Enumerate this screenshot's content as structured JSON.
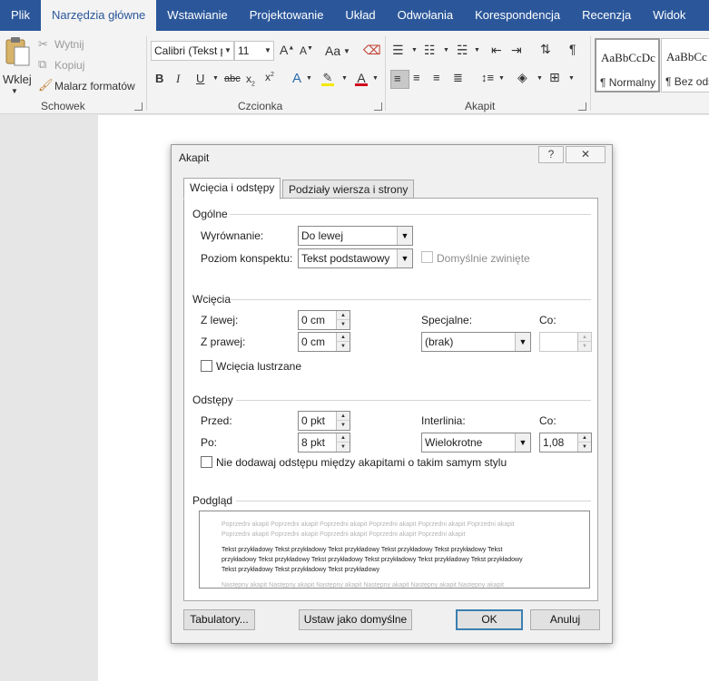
{
  "ribbon": {
    "tabs": [
      "Plik",
      "Narzędzia główne",
      "Wstawianie",
      "Projektowanie",
      "Układ",
      "Odwołania",
      "Korespondencja",
      "Recenzja",
      "Widok"
    ],
    "active_tab": "Narzędzia główne",
    "clipboard": {
      "paste": "Wklej",
      "cut": "Wytnij",
      "copy": "Kopiuj",
      "format_painter": "Malarz formatów",
      "group_label": "Schowek"
    },
    "font": {
      "font_name": "Calibri (Tekst p",
      "font_size": "11",
      "change_case": "Aa",
      "group_label": "Czcionka"
    },
    "paragraph": {
      "group_label": "Akapit",
      "pilcrow": "¶"
    },
    "styles": [
      {
        "sample": "AaBbCcDc",
        "name": "¶ Normalny"
      },
      {
        "sample": "AaBbCc",
        "name": "¶ Bez ods"
      }
    ]
  },
  "dialog": {
    "title": "Akapit",
    "help": "?",
    "close": "✕",
    "tabs": [
      "Wcięcia i odstępy",
      "Podziały wiersza i strony"
    ],
    "general": {
      "section": "Ogólne",
      "alignment_label": "Wyrównanie:",
      "alignment_value": "Do lewej",
      "outline_label": "Poziom konspektu:",
      "outline_value": "Tekst podstawowy",
      "collapsed_label": "Domyślnie zwinięte"
    },
    "indent": {
      "section": "Wcięcia",
      "left_label": "Z lewej:",
      "left_value": "0 cm",
      "right_label": "Z prawej:",
      "right_value": "0 cm",
      "special_label": "Specjalne:",
      "special_value": "(brak)",
      "by_label": "Co:",
      "by_value": "",
      "mirror_label": "Wcięcia lustrzane"
    },
    "spacing": {
      "section": "Odstępy",
      "before_label": "Przed:",
      "before_value": "0 pkt",
      "after_label": "Po:",
      "after_value": "8 pkt",
      "line_label": "Interlinia:",
      "line_value": "Wielokrotne",
      "at_label": "Co:",
      "at_value": "1,08",
      "no_space_label": "Nie dodawaj odstępu między akapitami o takim samym stylu"
    },
    "preview": {
      "section": "Podgląd",
      "prev_line1": "Poprzedni akapit Poprzedni akapit Poprzedni akapit Poprzedni akapit Poprzedni akapit Poprzedni akapit",
      "prev_line2": "Poprzedni akapit Poprzedni akapit Poprzedni akapit Poprzedni akapit Poprzedni akapit",
      "sample_line1": "Tekst przykładowy Tekst przykładowy Tekst przykładowy Tekst przykładowy Tekst przykładowy Tekst",
      "sample_line2": "przykładowy Tekst przykładowy Tekst przykładowy Tekst przykładowy Tekst przykładowy Tekst przykładowy",
      "sample_line3": "Tekst przykładowy Tekst przykładowy Tekst przykładowy",
      "next_line": "Następny akapit Następny akapit Następny akapit Następny akapit Następny akapit Następny akapit"
    },
    "buttons": {
      "tabs": "Tabulatory...",
      "set_default": "Ustaw jako domyślne",
      "ok": "OK",
      "cancel": "Anuluj"
    }
  }
}
